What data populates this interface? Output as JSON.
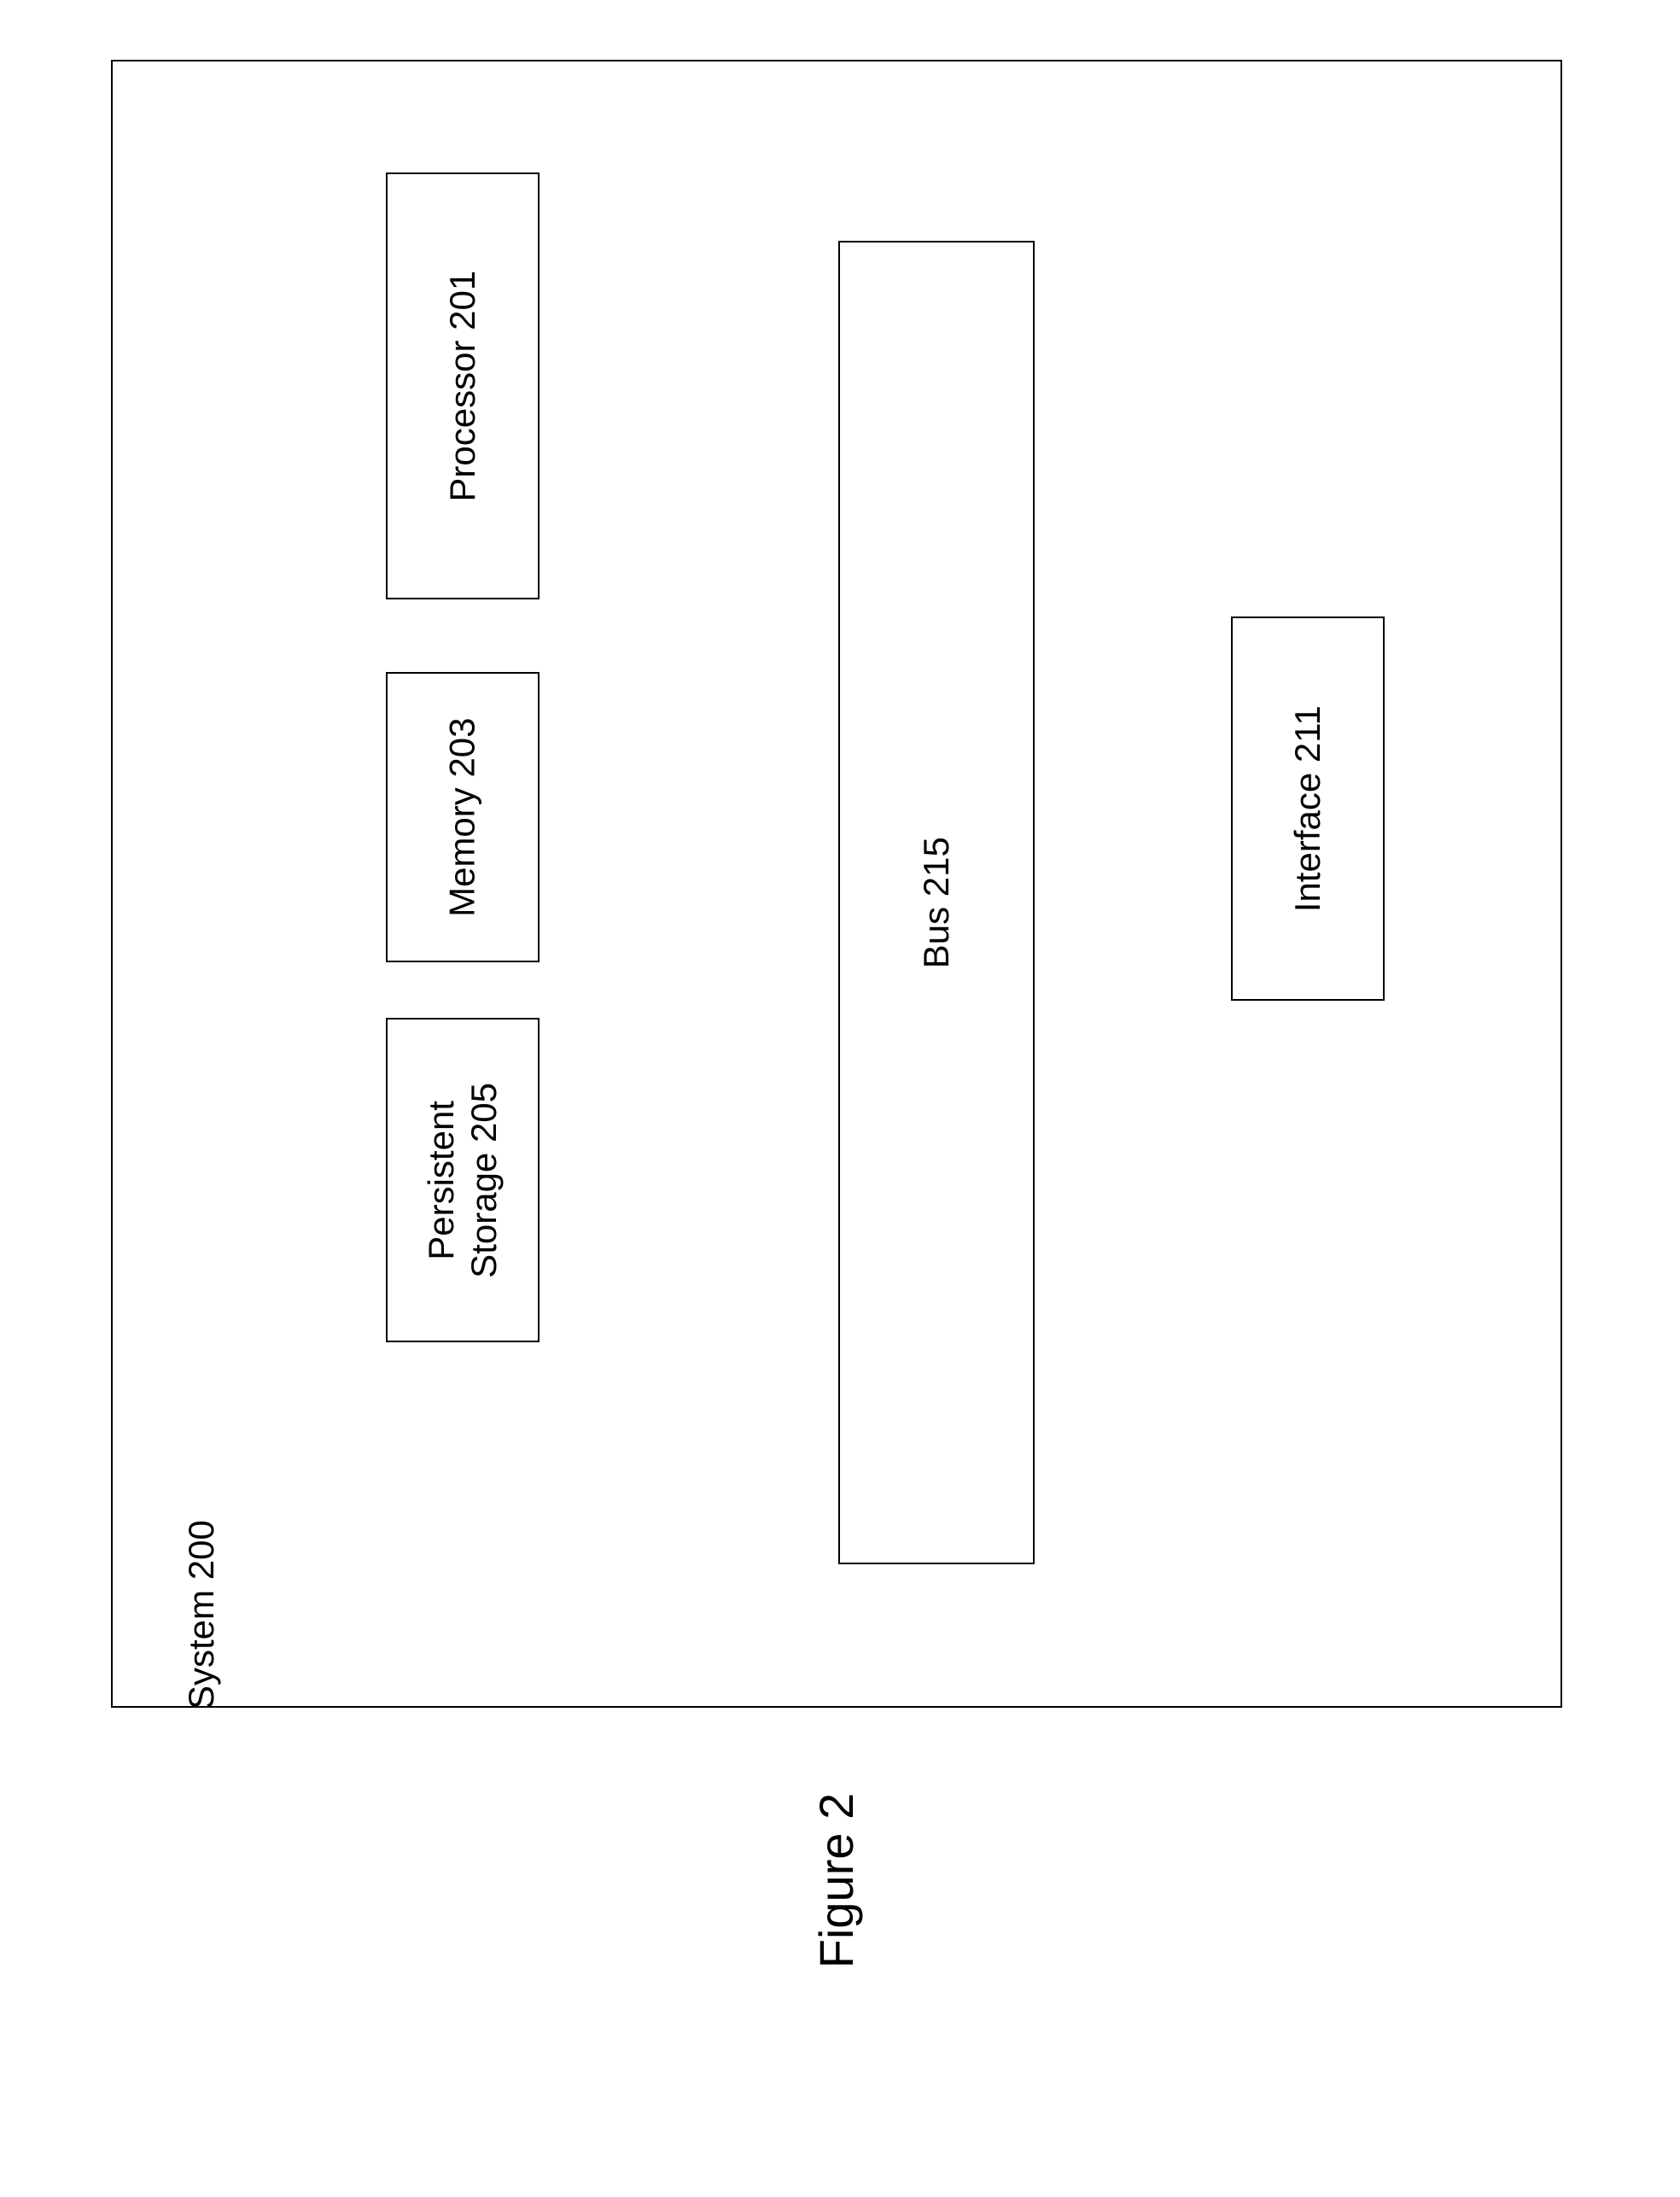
{
  "diagram": {
    "system_label": "System 200",
    "blocks": {
      "processor": "Processor 201",
      "memory": "Memory 203",
      "storage": "Persistent\nStorage 205",
      "bus": "Bus 215",
      "interface": "Interface 211"
    },
    "caption": "Figure 2"
  }
}
